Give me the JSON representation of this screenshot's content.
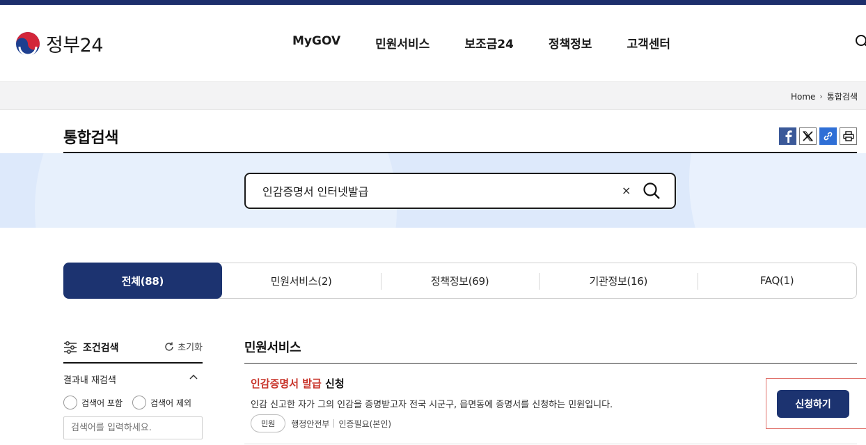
{
  "header": {
    "logo_text": "정부24",
    "nav": [
      "MyGOV",
      "민원서비스",
      "보조금24",
      "정책정보",
      "고객센터"
    ]
  },
  "breadcrumb": {
    "home": "Home",
    "current": "통합검색"
  },
  "page": {
    "title": "통합검색"
  },
  "search": {
    "query": "인감증명서 인터넷발급",
    "clear_symbol": "×"
  },
  "tabs": [
    {
      "label": "전체(88)",
      "active": true
    },
    {
      "label": "민원서비스(2)",
      "active": false
    },
    {
      "label": "정책정보(69)",
      "active": false
    },
    {
      "label": "기관정보(16)",
      "active": false
    },
    {
      "label": "FAQ(1)",
      "active": false
    }
  ],
  "filter": {
    "title": "조건검색",
    "reset_label": "초기화",
    "refine_label": "결과내 재검색",
    "include_label": "검색어 포함",
    "exclude_label": "검색어 제외",
    "placeholder": "검색어를 입력하세요."
  },
  "results": {
    "section_title": "민원서비스",
    "items": [
      {
        "title_highlight": "인감증명서 발급",
        "title_rest": " 신청",
        "description": "인감 신고한 자가 그의 인감을 증명받고자 전국 시군구, 읍면동에 증명서를 신청하는 민원입니다.",
        "tag": "민원",
        "agency": "행정안전부",
        "auth": "인증필요(본인)",
        "button_label": "신청하기"
      }
    ]
  },
  "colors": {
    "brand_navy": "#1c3370",
    "top_bar": "#1d2f6c",
    "highlight_red": "#c8352b",
    "search_band": "#dde9fb"
  }
}
